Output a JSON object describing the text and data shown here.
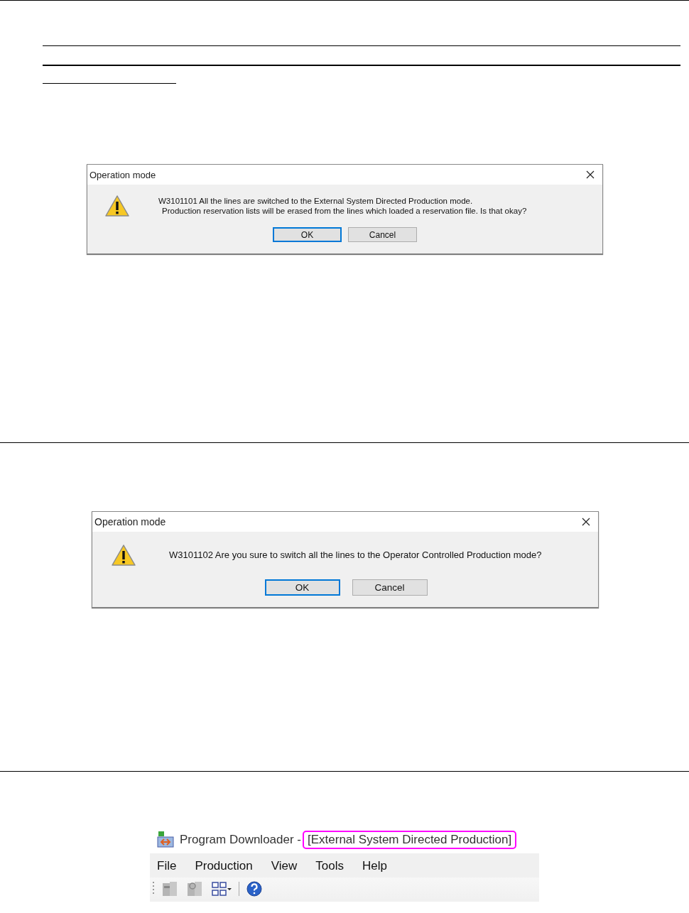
{
  "dialogs": [
    {
      "title": "Operation mode",
      "message_lines": [
        "W3101101 All the lines are switched to the External System Directed Production mode.",
        "Production reservation lists will be erased from the lines which loaded a reservation file. Is that okay?"
      ],
      "buttons": [
        {
          "label": "OK",
          "focused": true
        },
        {
          "label": "Cancel",
          "focused": false
        }
      ]
    },
    {
      "title": "Operation mode",
      "message_lines": [
        "W3101102 Are you sure to switch all the lines to the Operator Controlled Production mode?"
      ],
      "buttons": [
        {
          "label": "OK",
          "focused": true
        },
        {
          "label": "Cancel",
          "focused": false
        }
      ]
    }
  ],
  "app_window": {
    "title": "Program Downloader -",
    "mode": {
      "text": "[External System Directed Production]",
      "highlighted": true
    },
    "menu": [
      "File",
      "Production",
      "View",
      "Tools",
      "Help"
    ]
  }
}
